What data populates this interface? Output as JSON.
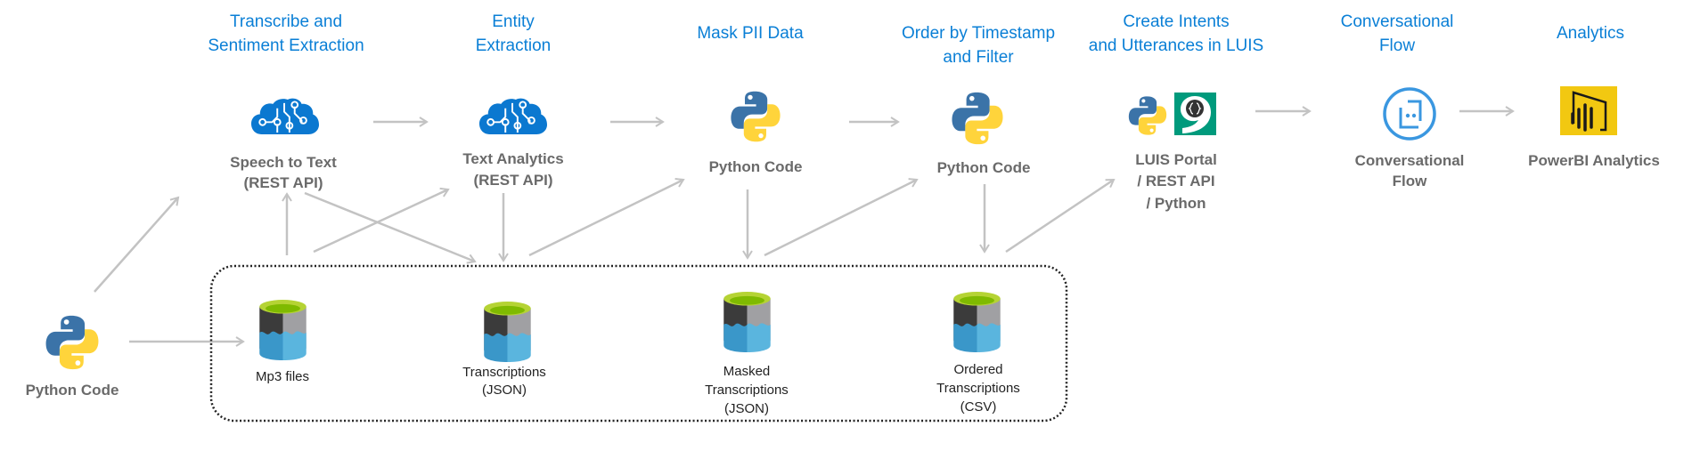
{
  "stages": [
    {
      "lines": [
        "Transcribe and",
        "Sentiment Extraction"
      ]
    },
    {
      "lines": [
        "Entity",
        "Extraction"
      ]
    },
    {
      "lines": [
        "Mask PII Data"
      ]
    },
    {
      "lines": [
        "Order by Timestamp",
        "and Filter"
      ]
    },
    {
      "lines": [
        "Create Intents",
        "and Utterances in LUIS"
      ]
    },
    {
      "lines": [
        "Conversational",
        "Flow"
      ]
    },
    {
      "lines": [
        "Analytics"
      ]
    }
  ],
  "nodes": {
    "source_python": {
      "lines": [
        "Python Code"
      ],
      "icon": "python-icon"
    },
    "speech_to_text": {
      "lines": [
        "Speech to Text",
        "(REST API)"
      ],
      "icon": "cognitive-services-brain-icon"
    },
    "text_analytics": {
      "lines": [
        "Text Analytics",
        "(REST API)"
      ],
      "icon": "cognitive-services-brain-icon"
    },
    "mask_python": {
      "lines": [
        "Python Code"
      ],
      "icon": "python-icon"
    },
    "order_python": {
      "lines": [
        "Python Code"
      ],
      "icon": "python-icon"
    },
    "luis": {
      "lines": [
        "LUIS Portal",
        "/ REST API",
        "/ Python"
      ],
      "icon": "luis-icon"
    },
    "conversational_flow": {
      "lines": [
        "Conversational",
        "Flow"
      ],
      "icon": "bot-chat-icon"
    },
    "powerbi": {
      "lines": [
        "PowerBI Analytics"
      ],
      "icon": "powerbi-icon"
    }
  },
  "storage": [
    {
      "lines": [
        "Mp3 files"
      ]
    },
    {
      "lines": [
        "Transcriptions",
        "(JSON)"
      ]
    },
    {
      "lines": [
        "Masked",
        "Transcriptions",
        "(JSON)"
      ]
    },
    {
      "lines": [
        "Ordered",
        "Transcriptions",
        "(CSV)"
      ]
    }
  ],
  "colors": {
    "stage_title": "#0a7fd6",
    "node_label": "#6a6a6a",
    "arrow": "#c3c3c3",
    "azure_blue": "#0078d4",
    "luis_green": "#009a7c",
    "powerbi_yellow": "#f2c811"
  }
}
